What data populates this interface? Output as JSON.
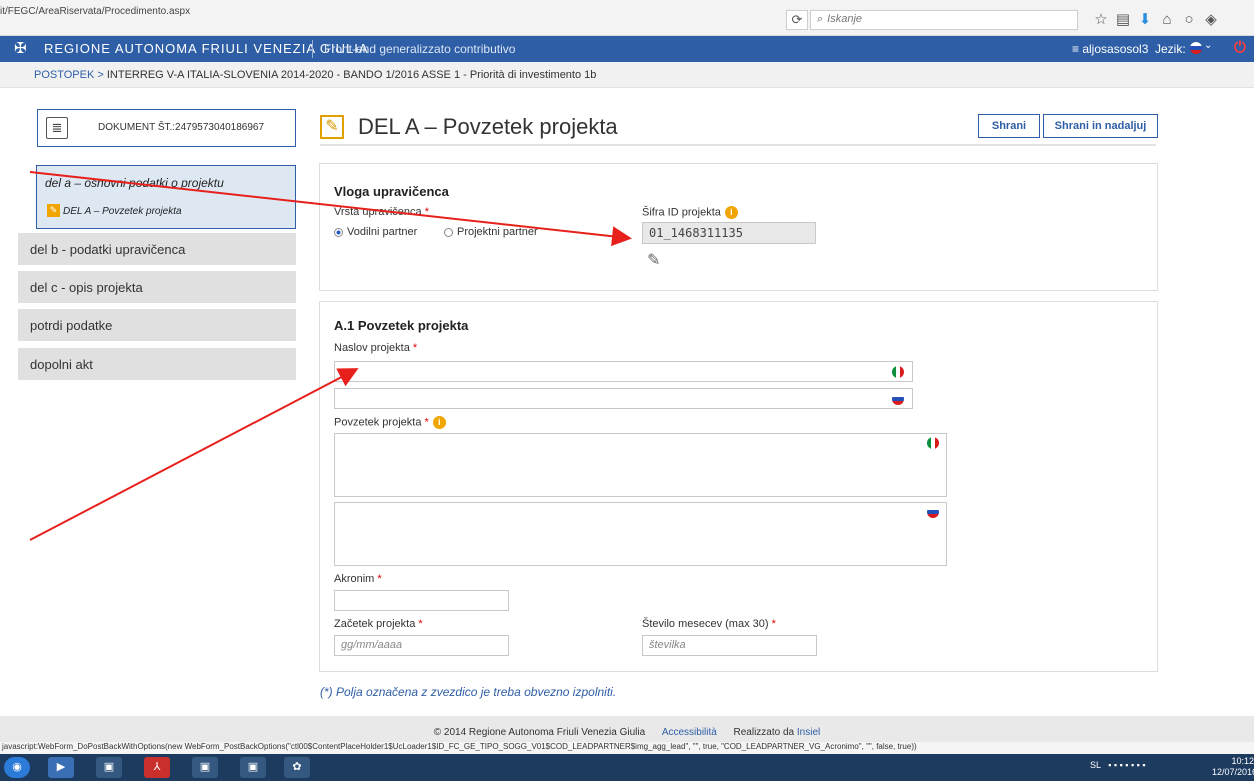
{
  "browser": {
    "url": "it/FEGC/AreaRiservata/Procedimento.aspx",
    "search_placeholder": "Iskanje",
    "reload_icon": "reload-icon",
    "nav_icons": [
      "star-icon",
      "bookmark-icon",
      "download-icon",
      "home-icon",
      "circle-icon",
      "shield-icon"
    ]
  },
  "header": {
    "region": "Regione Autonoma Friuli Venezia Giulia",
    "app": "Front-end generalizzato contributivo",
    "user": "≡ aljosasosol3",
    "lang_label": "Jezik:",
    "accent": "#2e5ea6"
  },
  "breadcrumb": {
    "root": "POSTOPEK >",
    "path": "INTERREG V-A ITALIA-SLOVENIA 2014-2020 - BANDO 1/2016 ASSE 1 - Priorità di investimento 1b"
  },
  "document": {
    "label": "DOKUMENT ŠT.:2479573040186967"
  },
  "sidebar": {
    "section_a": "del a – osnovni podatki o projektu",
    "section_a_sub": "DEL A – Povzetek projekta",
    "items": [
      {
        "label": "del b - podatki upravičenca"
      },
      {
        "label": "del c - opis projekta"
      },
      {
        "label": "potrdi podatke"
      },
      {
        "label": "dopolni akt"
      }
    ]
  },
  "main": {
    "title": "DEL A – Povzetek projekta",
    "save": "Shrani",
    "save_continue": "Shrani in nadaljuj"
  },
  "panel1": {
    "title": "Vloga upravičenca",
    "type_label": "Vrsta upravičenca",
    "opt1": "Vodilni partner",
    "opt2": "Projektni partner",
    "id_label": "Šifra ID projekta",
    "id_value": "01_1468311135"
  },
  "panel2": {
    "title": "A.1 Povzetek projekta",
    "naslov_label": "Naslov projekta",
    "povzetek_label": "Povzetek projekta",
    "akronim_label": "Akronim",
    "zacetek_label": "Začetek projekta",
    "zacetek_ph": "gg/mm/aaaa",
    "stevilo_label": "Število mesecev (max 30)",
    "stevilo_ph": "številka"
  },
  "note": "(*) Polja označena z zvezdico je treba obvezno izpolniti.",
  "footer": {
    "copy": "© 2014 Regione Autonoma Friuli Venezia Giulia",
    "access": "Accessibilità",
    "realized": "Realizzato da",
    "realized_by": "Insiel"
  },
  "statusbar": "javascript:WebForm_DoPostBackWithOptions(new WebForm_PostBackOptions(\"ctl00$ContentPlaceHolder1$UcLoader1$ID_FC_GE_TIPO_SOGG_V01$COD_LEADPARTNER$img_agg_lead\", \"\", true, \"COD_LEADPARTNER_VG_Acronimo\", \"\", false, true))",
  "taskbar": {
    "lang": "SL",
    "time": "10:12",
    "date": "12/07/2016"
  },
  "annotation_color": "#e8201c"
}
